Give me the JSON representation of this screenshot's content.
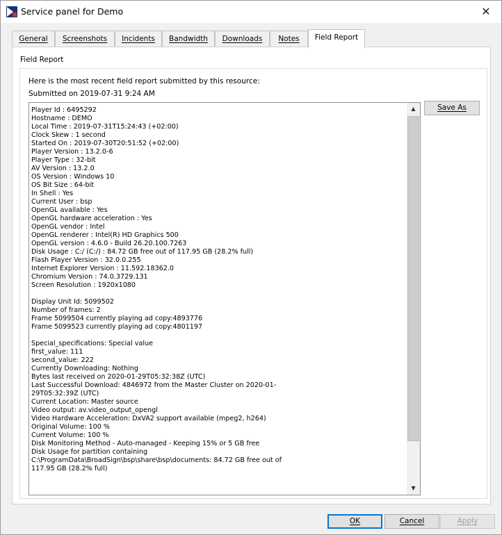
{
  "window": {
    "title": "Service panel for Demo",
    "close_symbol": "✕"
  },
  "tabs": [
    {
      "label": "General"
    },
    {
      "label": "Screenshots"
    },
    {
      "label": "Incidents"
    },
    {
      "label": "Bandwidth"
    },
    {
      "label": "Downloads"
    },
    {
      "label": "Notes"
    },
    {
      "label": "Field Report"
    }
  ],
  "active_tab": "Field Report",
  "panel": {
    "title": "Field Report",
    "intro": "Here is the most recent field report submitted by this resource:",
    "submitted": "Submitted on 2019-07-31 9:24 AM",
    "report_lines": [
      "Player Id : 6495292",
      "Hostname : DEMO",
      "Local Time : 2019-07-31T15:24:43 (+02:00)",
      "Clock Skew : 1 second",
      "Started On : 2019-07-30T20:51:52 (+02:00)",
      "Player Version : 13.2.0-6",
      "Player Type : 32-bit",
      "AV Version : 13.2.0",
      "OS Version : Windows 10",
      "OS Bit Size : 64-bit",
      "In Shell : Yes",
      "Current User : bsp",
      "OpenGL available : Yes",
      "OpenGL hardware acceleration : Yes",
      "OpenGL vendor : Intel",
      "OpenGL renderer : Intel(R) HD Graphics 500",
      "OpenGL version : 4.6.0 - Build 26.20.100.7263",
      "Disk Usage : C:/ (C:/) : 84.72 GB free out of 117.95 GB (28.2% full)",
      "Flash Player Version : 32.0.0.255",
      "Internet Explorer Version : 11.592.18362.0",
      "Chromium Version : 74.0.3729.131",
      "Screen Resolution : 1920x1080",
      "",
      "Display Unit Id: 5099502",
      "Number of frames: 2",
      "Frame 5099504 currently playing ad copy:4893776",
      "Frame 5099523 currently playing ad copy:4801197",
      "",
      "Special_specifications: Special value",
      "first_value: 111",
      "second_value: 222",
      "Currently Downloading: Nothing",
      "Bytes last received on 2020-01-29T05:32:38Z (UTC)",
      "Last Successful Download: 4846972 from the Master Cluster on 2020-01-",
      "29T05:32:39Z (UTC)",
      "Current Location: Master source",
      "Video output: av.video_output_opengl",
      "Video Hardware Acceleration: DxVA2 support available (mpeg2, h264)",
      "Original Volume: 100 %",
      "Current Volume: 100 %",
      "Disk Monitoring Method - Auto-managed - Keeping 15% or 5 GB free",
      "Disk Usage for partition containing",
      "C:\\ProgramData\\BroadSign\\bsp\\share\\bsp\\documents: 84.72 GB free out of",
      "117.95 GB (28.2% full)"
    ],
    "save_as_label": "Save As"
  },
  "footer": {
    "ok_label": "OK",
    "cancel_label": "Cancel",
    "apply_label": "Apply"
  },
  "scrollbar": {
    "up_symbol": "▲",
    "down_symbol": "▼"
  },
  "colors": {
    "accent": "#0078d7",
    "app_icon": "#1c2f7a"
  }
}
